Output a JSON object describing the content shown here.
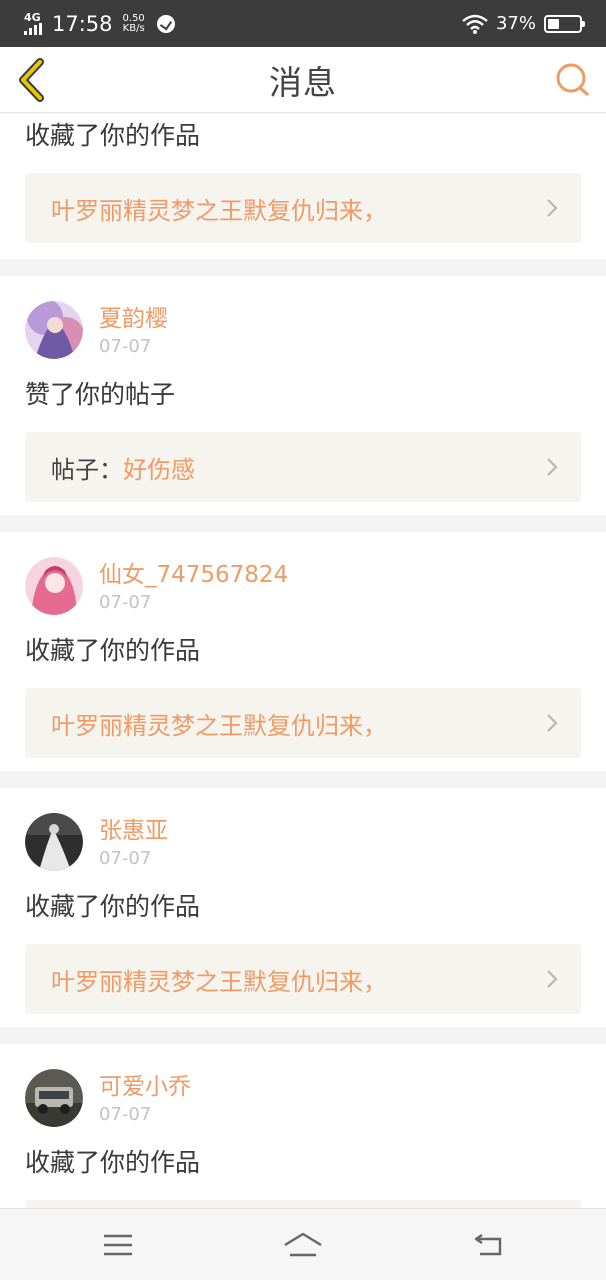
{
  "status_bar": {
    "network": "4G",
    "time": "17:58",
    "speed_value": "0.50",
    "speed_unit": "KB/s",
    "battery_percent": "37%",
    "battery_level": 0.37
  },
  "header": {
    "title": "消息",
    "back_icon": "chevron-left-icon",
    "search_icon": "search-icon"
  },
  "colors": {
    "accent": "#f09a66",
    "back_arrow": "#e8c800",
    "ref_background": "#f5f4ee"
  },
  "messages": [
    {
      "action": "收藏了你的作品",
      "ref_text": "叶罗丽精灵梦之王默复仇归来，"
    },
    {
      "user": "夏韵樱",
      "date": "07-07",
      "action": "赞了你的帖子",
      "ref_label": "帖子：",
      "ref_text": "好伤感"
    },
    {
      "user": "仙女_747567824",
      "date": "07-07",
      "action": "收藏了你的作品",
      "ref_text": "叶罗丽精灵梦之王默复仇归来，"
    },
    {
      "user": "张惠亚",
      "date": "07-07",
      "action": "收藏了你的作品",
      "ref_text": "叶罗丽精灵梦之王默复仇归来，"
    },
    {
      "user": "可爱小乔",
      "date": "07-07",
      "action": "收藏了你的作品"
    }
  ],
  "navbar": {
    "menu_icon": "menu-icon",
    "home_icon": "home-icon",
    "back_icon": "back-icon"
  }
}
